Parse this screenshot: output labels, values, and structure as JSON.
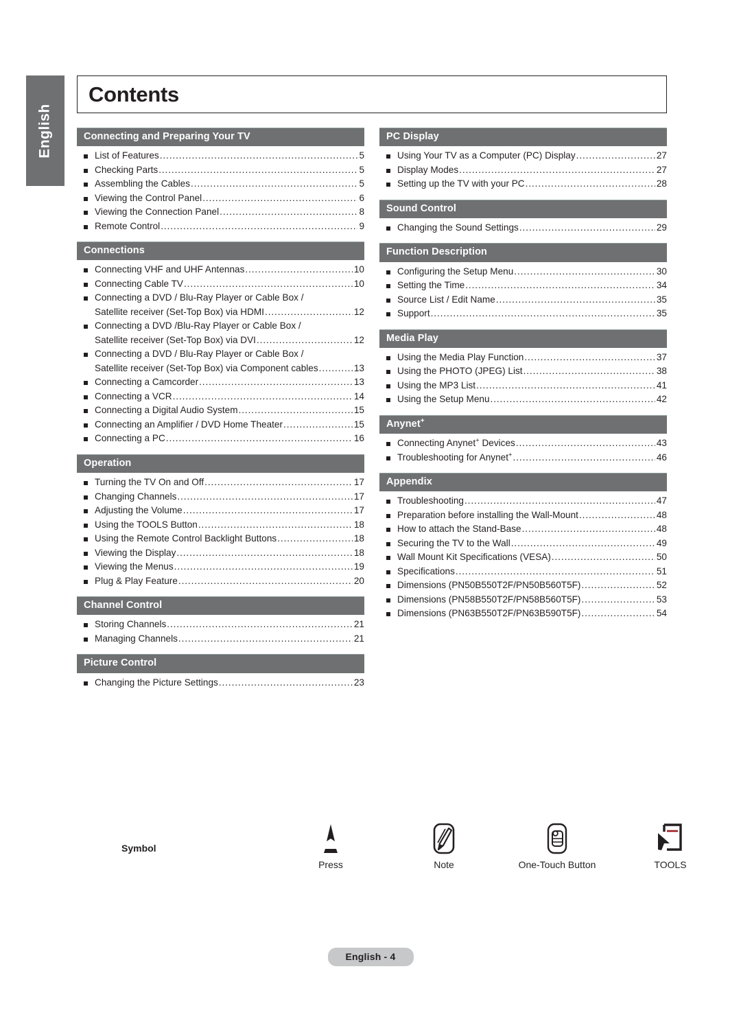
{
  "page": {
    "title": "Contents",
    "language_tab": "English",
    "footer": "English - 4"
  },
  "colors": {
    "section_header_bg": "#6e7071",
    "section_header_text": "#ffffff",
    "body_text": "#231f20",
    "footer_pill_bg": "#c7c8ca",
    "tools_accent": "#9e1b20"
  },
  "columns": {
    "left": [
      {
        "heading": "Connecting and Preparing Your TV",
        "entries": [
          {
            "label": "List of Features",
            "page": "5"
          },
          {
            "label": "Checking Parts",
            "page": "5"
          },
          {
            "label": "Assembling the Cables",
            "page": "5"
          },
          {
            "label": "Viewing the Control Panel",
            "page": "6"
          },
          {
            "label": "Viewing the Connection Panel",
            "page": "8"
          },
          {
            "label": "Remote Control",
            "page": "9"
          }
        ]
      },
      {
        "heading": "Connections",
        "entries": [
          {
            "label": "Connecting VHF and UHF Antennas",
            "page": "10"
          },
          {
            "label": "Connecting Cable TV",
            "page": "10"
          },
          {
            "label": "Connecting a DVD / Blu-Ray Player or Cable Box /",
            "label2": "Satellite receiver (Set-Top Box) via HDMI",
            "page": "12"
          },
          {
            "label": "Connecting a DVD /Blu-Ray Player or Cable Box /",
            "label2": "Satellite receiver (Set-Top Box) via DVI",
            "page": "12"
          },
          {
            "label": "Connecting a DVD / Blu-Ray Player or Cable Box /",
            "label2": "Satellite receiver (Set-Top Box) via Component cables",
            "page": "13"
          },
          {
            "label": "Connecting a Camcorder",
            "page": "13"
          },
          {
            "label": "Connecting a VCR",
            "page": "14"
          },
          {
            "label": "Connecting a Digital Audio System",
            "page": "15"
          },
          {
            "label": "Connecting an Amplifier / DVD Home Theater",
            "page": "15"
          },
          {
            "label": "Connecting a PC",
            "page": "16"
          }
        ]
      },
      {
        "heading": "Operation",
        "entries": [
          {
            "label": "Turning the TV On and Off",
            "page": "17"
          },
          {
            "label": "Changing Channels",
            "page": "17"
          },
          {
            "label": "Adjusting the Volume",
            "page": "17"
          },
          {
            "label": "Using the TOOLS Button",
            "page": "18"
          },
          {
            "label": "Using the Remote Control Backlight Buttons",
            "page": "18"
          },
          {
            "label": "Viewing the Display",
            "page": "18"
          },
          {
            "label": "Viewing the Menus",
            "page": "19"
          },
          {
            "label": "Plug & Play Feature",
            "page": "20"
          }
        ]
      },
      {
        "heading": "Channel Control",
        "entries": [
          {
            "label": "Storing Channels",
            "page": "21"
          },
          {
            "label": "Managing Channels",
            "page": "21"
          }
        ]
      },
      {
        "heading": "Picture Control",
        "entries": [
          {
            "label": "Changing the Picture Settings",
            "page": "23"
          }
        ]
      }
    ],
    "right": [
      {
        "heading": "PC Display",
        "entries": [
          {
            "label": "Using Your TV as a Computer (PC) Display",
            "page": "27"
          },
          {
            "label": "Display Modes",
            "page": "27"
          },
          {
            "label": "Setting up the TV with your PC",
            "page": "28"
          }
        ]
      },
      {
        "heading": "Sound Control",
        "entries": [
          {
            "label": "Changing the Sound Settings",
            "page": "29"
          }
        ]
      },
      {
        "heading": "Function Description",
        "entries": [
          {
            "label": "Configuring the Setup Menu",
            "page": "30"
          },
          {
            "label": "Setting the Time",
            "page": "34"
          },
          {
            "label": "Source List / Edit Name",
            "page": "35"
          },
          {
            "label": "Support",
            "page": "35"
          }
        ]
      },
      {
        "heading": "Media Play",
        "entries": [
          {
            "label": "Using the Media Play Function",
            "page": "37"
          },
          {
            "label": "Using the PHOTO (JPEG) List",
            "page": "38"
          },
          {
            "label": "Using the MP3 List",
            "page": "41"
          },
          {
            "label": "Using the Setup Menu",
            "page": "42"
          }
        ]
      },
      {
        "heading": "Anynet",
        "heading_sup": "+",
        "entries": [
          {
            "label": "Connecting Anynet",
            "sup": "+",
            "label_tail": " Devices",
            "page": "43"
          },
          {
            "label": "Troubleshooting for Anynet",
            "sup": "+",
            "label_tail": "",
            "page": "46"
          }
        ]
      },
      {
        "heading": "Appendix",
        "entries": [
          {
            "label": "Troubleshooting",
            "page": "47"
          },
          {
            "label": "Preparation before installing the Wall-Mount",
            "page": "48"
          },
          {
            "label": "How to attach the Stand-Base",
            "page": "48"
          },
          {
            "label": "Securing the TV to the Wall",
            "page": "49"
          },
          {
            "label": "Wall Mount Kit Specifications (VESA)",
            "page": "50"
          },
          {
            "label": "Specifications",
            "page": "51"
          },
          {
            "label": "Dimensions (PN50B550T2F/PN50B560T5F)",
            "page": "52"
          },
          {
            "label": "Dimensions (PN58B550T2F/PN58B560T5F)",
            "page": "53"
          },
          {
            "label": "Dimensions (PN63B550T2F/PN63B590T5F)",
            "page": "54"
          }
        ]
      }
    ]
  },
  "legend": {
    "title": "Symbol",
    "items": [
      {
        "icon": "press-icon",
        "caption": "Press"
      },
      {
        "icon": "note-pencil-icon",
        "caption": "Note"
      },
      {
        "icon": "one-touch-button-icon",
        "caption": "One-Touch Button"
      },
      {
        "icon": "tools-cursor-icon",
        "caption": "TOOLS"
      }
    ]
  }
}
